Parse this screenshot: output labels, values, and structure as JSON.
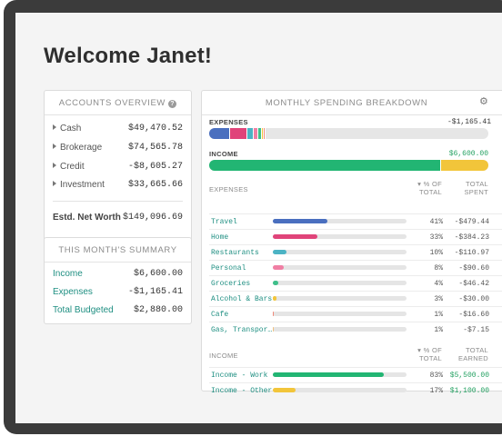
{
  "welcome": "Welcome Janet!",
  "accounts": {
    "title": "ACCOUNTS OVERVIEW",
    "help_icon": "question-circle-icon",
    "items": [
      {
        "label": "Cash",
        "value": "$49,470.52"
      },
      {
        "label": "Brokerage",
        "value": "$74,565.78"
      },
      {
        "label": "Credit",
        "value": "-$8,605.27"
      },
      {
        "label": "Investment",
        "value": "$33,665.66"
      }
    ],
    "net_label": "Estd. Net Worth",
    "net_value": "$149,096.69"
  },
  "summary": {
    "title": "THIS MONTH'S SUMMARY",
    "items": [
      {
        "label": "Income",
        "value": "$6,600.00"
      },
      {
        "label": "Expenses",
        "value": "-$1,165.41"
      },
      {
        "label": "Total Budgeted",
        "value": "$2,880.00"
      }
    ]
  },
  "breakdown": {
    "title": "MONTHLY SPENDING BREAKDOWN",
    "settings_icon": "gear-icon",
    "expenses_label": "EXPENSES",
    "expenses_total": "-$1,165.41",
    "income_label": "INCOME",
    "income_total": "$6,600.00",
    "expense_segments": [
      {
        "percent": 41,
        "color": "#4a6fbf"
      },
      {
        "percent": 33,
        "color": "#e0447a"
      },
      {
        "percent": 10,
        "color": "#4cb3c4"
      },
      {
        "percent": 8,
        "color": "#f07fa4"
      },
      {
        "percent": 4,
        "color": "#3fbf8a"
      },
      {
        "percent": 3,
        "color": "#f2c53a"
      },
      {
        "percent": 1,
        "color": "#f08a7a"
      },
      {
        "percent": 1,
        "color": "#f0c080"
      }
    ],
    "expenses_bar_fraction": 0.18,
    "income_segments": [
      {
        "percent": 83,
        "color": "#22b573"
      },
      {
        "percent": 17,
        "color": "#f2c53a"
      }
    ],
    "expense_headers": {
      "category": "EXPENSES",
      "pct_line1": "▾ % OF",
      "pct_line2": "TOTAL",
      "amt_line1": "TOTAL",
      "amt_line2": "SPENT"
    },
    "expense_rows": [
      {
        "name": "Travel",
        "pct": "41%",
        "amount": "-$479.44",
        "bar": 0.41,
        "color": "#4a6fbf"
      },
      {
        "name": "Home",
        "pct": "33%",
        "amount": "-$384.23",
        "bar": 0.33,
        "color": "#e0447a"
      },
      {
        "name": "Restaurants",
        "pct": "10%",
        "amount": "-$110.97",
        "bar": 0.1,
        "color": "#4cb3c4"
      },
      {
        "name": "Personal",
        "pct": "8%",
        "amount": "-$90.60",
        "bar": 0.08,
        "color": "#f07fa4"
      },
      {
        "name": "Groceries",
        "pct": "4%",
        "amount": "-$46.42",
        "bar": 0.04,
        "color": "#3fbf8a"
      },
      {
        "name": "Alcohol & Bars",
        "pct": "3%",
        "amount": "-$30.00",
        "bar": 0.03,
        "color": "#f2c53a"
      },
      {
        "name": "Cafe",
        "pct": "1%",
        "amount": "-$16.60",
        "bar": 0.01,
        "color": "#f08a7a"
      },
      {
        "name": "Gas, Transpor…",
        "pct": "1%",
        "amount": "-$7.15",
        "bar": 0.01,
        "color": "#f0c080"
      }
    ],
    "income_headers": {
      "category": "INCOME",
      "pct_line1": "▾ % OF",
      "pct_line2": "TOTAL",
      "amt_line1": "TOTAL",
      "amt_line2": "EARNED"
    },
    "income_rows": [
      {
        "name": "Income - Work",
        "pct": "83%",
        "amount": "$5,500.00",
        "bar": 0.83,
        "color": "#22b573"
      },
      {
        "name": "Income - Other",
        "pct": "17%",
        "amount": "$1,100.00",
        "bar": 0.17,
        "color": "#f2c53a"
      }
    ]
  }
}
